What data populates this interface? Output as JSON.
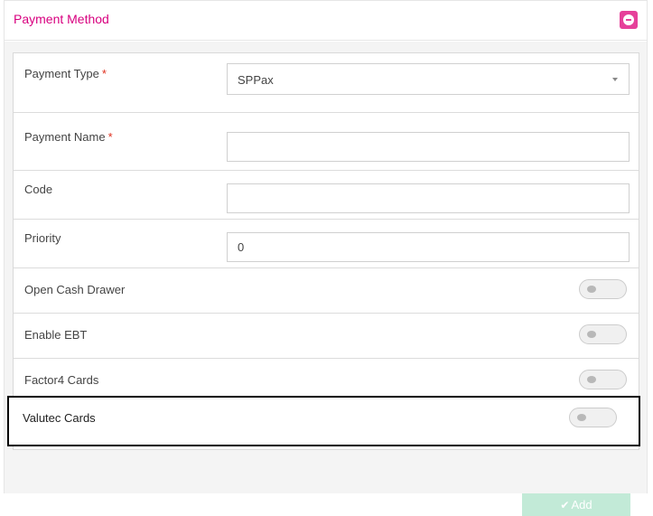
{
  "panel": {
    "title": "Payment Method",
    "collapse_icon": "minus-circle-icon",
    "accent_color": "#d8007f"
  },
  "form": {
    "payment_type": {
      "label": "Payment Type",
      "required_mark": "*",
      "selected": "SPPax",
      "caret_icon": "caret-down-icon"
    },
    "payment_name": {
      "label": "Payment Name",
      "required_mark": "*",
      "value": ""
    },
    "code": {
      "label": "Code",
      "value": ""
    },
    "priority": {
      "label": "Priority",
      "value": "0"
    },
    "open_cash_drawer": {
      "label": "Open Cash Drawer",
      "enabled": false
    },
    "enable_ebt": {
      "label": "Enable EBT",
      "enabled": false
    },
    "factor4_cards": {
      "label": "Factor4 Cards",
      "enabled": false
    },
    "valutec_cards": {
      "label": "Valutec Cards",
      "enabled": false
    }
  },
  "actions": {
    "add_label": "Add",
    "add_icon": "check-icon",
    "add_button_color": "#c2ead7"
  }
}
